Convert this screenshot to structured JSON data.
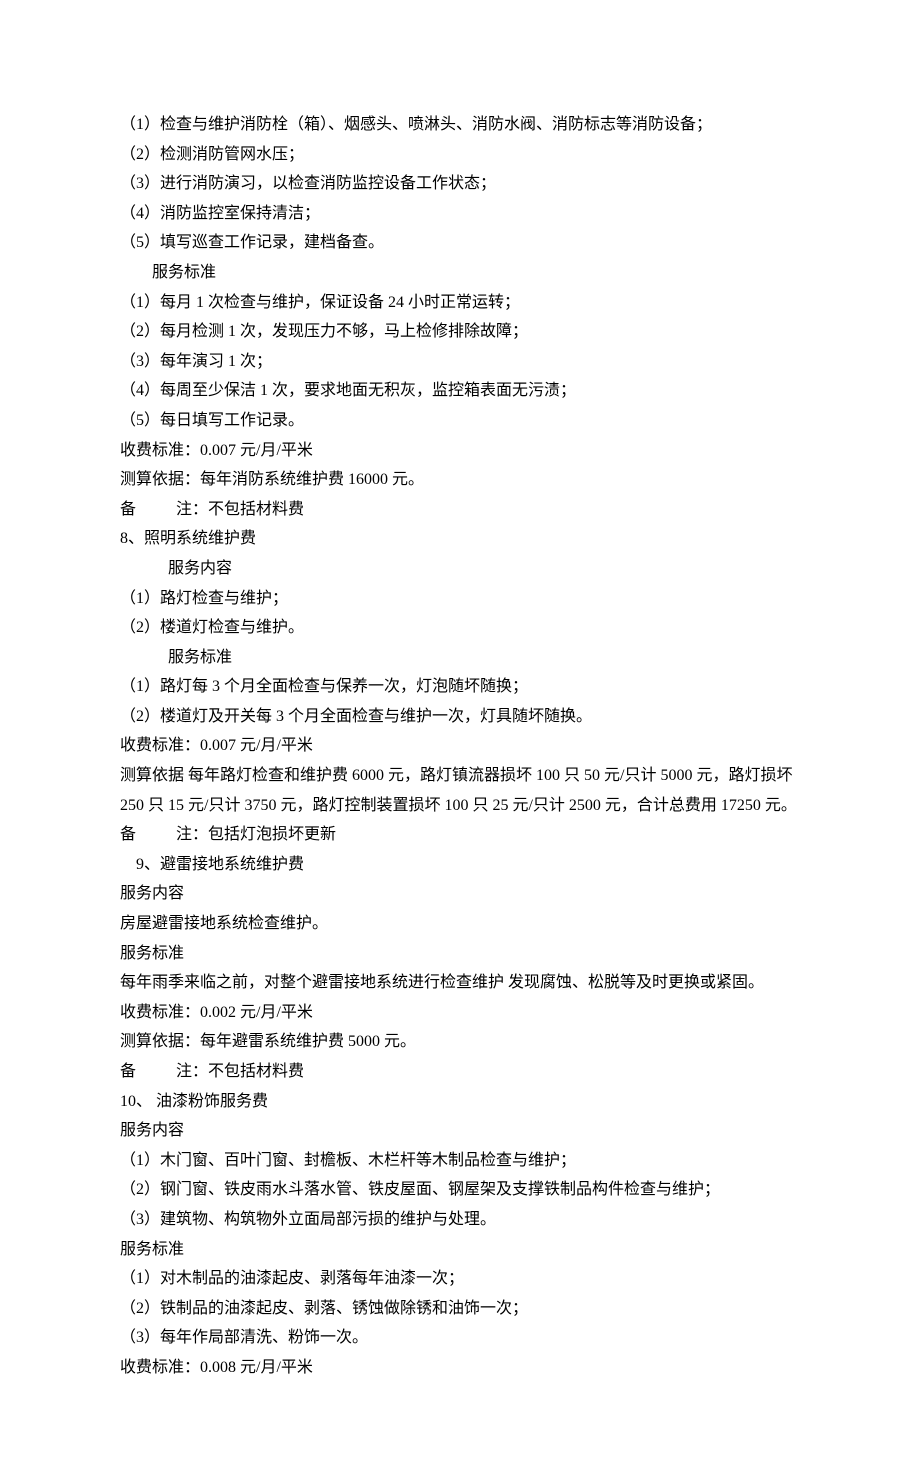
{
  "sec7": {
    "content": [
      "（1）检查与维护消防栓（箱）、烟感头、喷淋头、消防水阀、消防标志等消防设备；",
      "（2）检测消防管网水压；",
      "（3）进行消防演习，以检查消防监控设备工作状态；",
      "（4）消防监控室保持清洁；",
      "（5）填写巡查工作记录，建档备查。"
    ],
    "std_label": "服务标准",
    "std": [
      "（1）每月 1 次检查与维护，保证设备 24 小时正常运转；",
      "（2）每月检测 1 次，发现压力不够，马上检修排除故障；",
      "（3）每年演习 1 次；",
      "（4）每周至少保洁 1 次，要求地面无积灰，监控箱表面无污渍；",
      "（5）每日填写工作记录。"
    ],
    "fee": "收费标准：0.007 元/月/平米",
    "basis": "测算依据：每年消防系统维护费 16000 元。",
    "note": "备          注：不包括材料费"
  },
  "sec8": {
    "title": "8、照明系统维护费",
    "content_label": "服务内容",
    "content": [
      "（1）路灯检查与维护；",
      "（2）楼道灯检查与维护。"
    ],
    "std_label": "服务标准",
    "std": [
      "（1）路灯每 3 个月全面检查与保养一次，灯泡随坏随换；",
      "（2）楼道灯及开关每 3 个月全面检查与维护一次，灯具随坏随换。"
    ],
    "fee": "收费标准：0.007 元/月/平米",
    "basis": "测算依据 每年路灯检查和维护费 6000 元，路灯镇流器损坏 100 只 50 元/只计 5000 元，路灯损坏 250 只 15 元/只计 3750 元，路灯控制装置损坏 100 只 25 元/只计 2500 元，合计总费用 17250 元。",
    "note": "备          注：包括灯泡损坏更新"
  },
  "sec9": {
    "title": "9、避雷接地系统维护费",
    "content_label": "服务内容",
    "content": "房屋避雷接地系统检查维护。",
    "std_label": "服务标准",
    "std": "每年雨季来临之前，对整个避雷接地系统进行检查维护 发现腐蚀、松脱等及时更换或紧固。",
    "fee": "收费标准：0.002 元/月/平米",
    "basis": "测算依据：每年避雷系统维护费 5000 元。",
    "note": "备          注：不包括材料费"
  },
  "sec10": {
    "title": "10、 油漆粉饰服务费",
    "content_label": "服务内容",
    "content": [
      "（1）木门窗、百叶门窗、封檐板、木栏杆等木制品检查与维护；",
      "（2）钢门窗、铁皮雨水斗落水管、铁皮屋面、钢屋架及支撑铁制品构件检查与维护；",
      "（3）建筑物、构筑物外立面局部污损的维护与处理。"
    ],
    "std_label": "服务标准",
    "std": [
      "（1）对木制品的油漆起皮、剥落每年油漆一次；",
      "（2）铁制品的油漆起皮、剥落、锈蚀做除锈和油饰一次；",
      "（3）每年作局部清洗、粉饰一次。"
    ],
    "fee": "收费标准：0.008 元/月/平米"
  }
}
